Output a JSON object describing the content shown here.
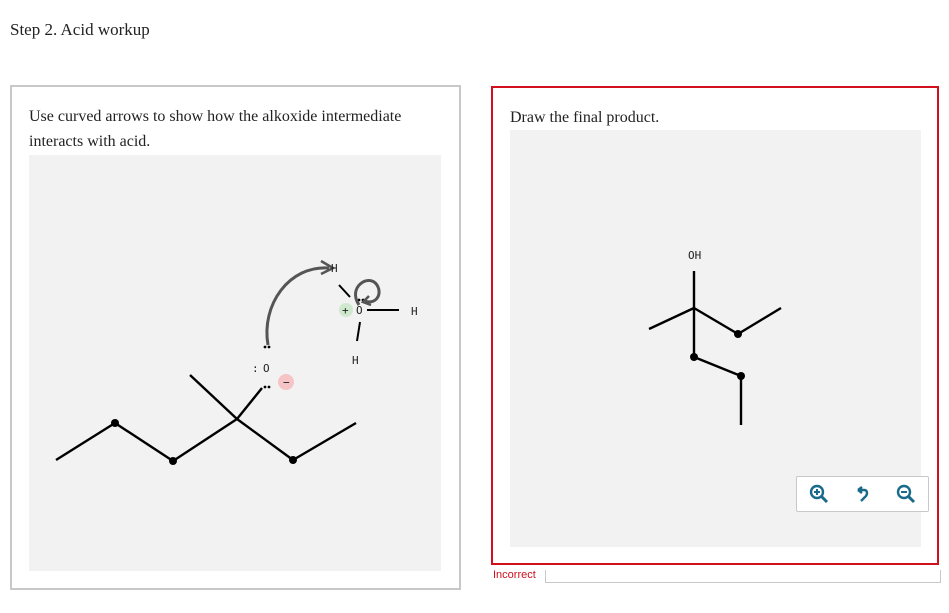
{
  "step_title": "Step 2. Acid workup",
  "left_panel": {
    "instruction": "Use curved arrows to show how the alkoxide intermediate interacts with acid.",
    "labels": {
      "oxygen": "O",
      "oxygen_lone_pair": ":",
      "hydronium_oxygen": "O",
      "hydrogen_top": "H",
      "hydrogen_right": "H",
      "hydrogen_bottom": "H",
      "plus_charge": "+",
      "minus_charge": "−"
    },
    "colors": {
      "positive_charge": "#cfe9cf",
      "negative_charge": "#f6c4c4",
      "arrow": "#555555",
      "bond": "#000000"
    }
  },
  "right_panel": {
    "instruction": "Draw the final product.",
    "labels": {
      "hydroxyl": "OH"
    },
    "toolbar": {
      "zoom_in": "zoom-in",
      "reset": "reset-view",
      "zoom_out": "zoom-out"
    },
    "colors": {
      "toolbar_icon": "#1a6b8a",
      "border_incorrect": "#d0101c"
    }
  },
  "feedback": {
    "status": "Incorrect"
  }
}
